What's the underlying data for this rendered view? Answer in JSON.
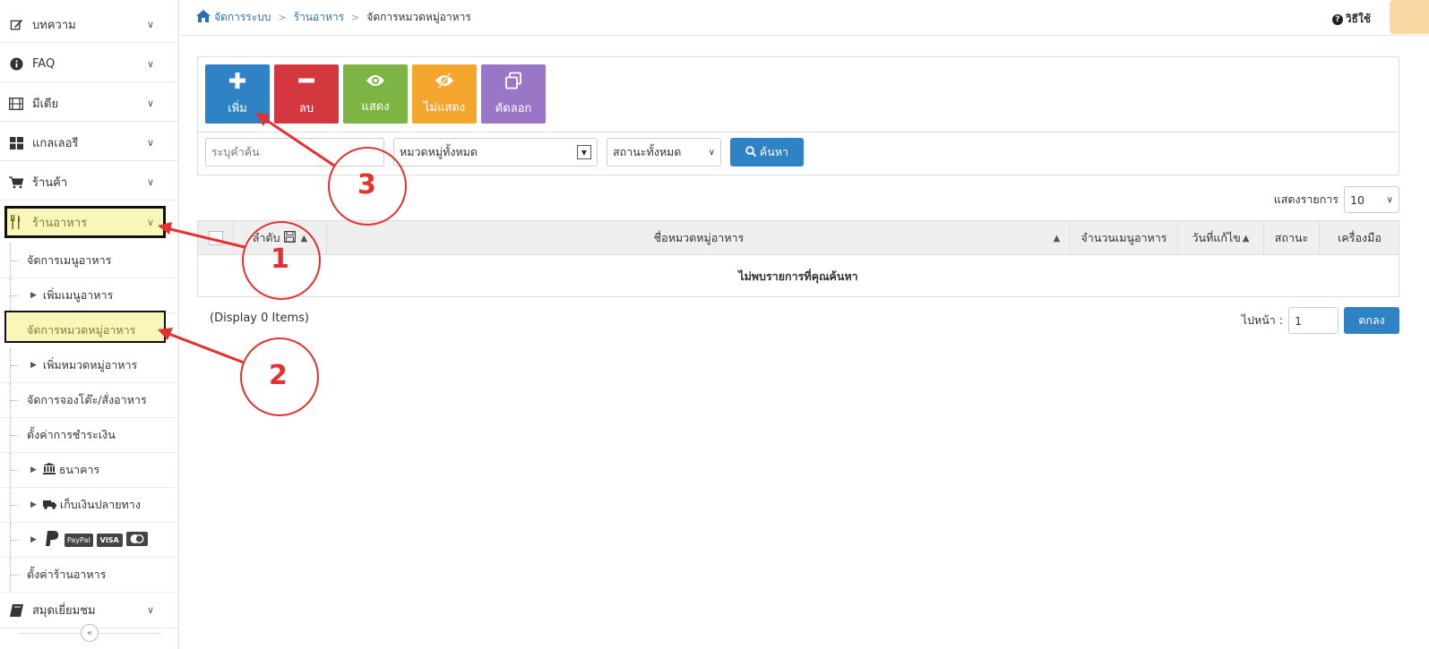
{
  "sidebar": {
    "items": [
      {
        "label": "บทความ",
        "icon": "edit-icon"
      },
      {
        "label": "FAQ",
        "icon": "info-icon"
      },
      {
        "label": "มีเดีย",
        "icon": "film-icon"
      },
      {
        "label": "แกลเลอรี",
        "icon": "grid-icon"
      },
      {
        "label": "ร้านค้า",
        "icon": "cart-icon"
      },
      {
        "label": "ร้านอาหาร",
        "icon": "utensils-icon"
      }
    ],
    "sub": {
      "menu_manage": "จัดการเมนูอาหาร",
      "menu_add": "เพิ่มเมนูอาหาร",
      "cat_manage": "จัดการหมวดหมู่อาหาร",
      "cat_add": "เพิ่มหมวดหมู่อาหาร",
      "booking": "จัดการจองโต๊ะ/สั่งอาหาร",
      "payment": "ตั้งค่าการชำระเงิน",
      "bank": "ธนาคาร",
      "cod": "เก็บเงินปลายทาง",
      "paypal": "PayPal",
      "visa": "VISA",
      "settings": "ตั้งค่าร้านอาหาร"
    },
    "guestbook": "สมุดเยี่ยมชม",
    "collapse": "«"
  },
  "header": {
    "breadcrumb": [
      "จัดการระบบ",
      "ร้านอาหาร",
      "จัดการหมวดหมู่อาหาร"
    ],
    "help": "วิธีใช้"
  },
  "toolbar": {
    "add": "เพิ่ม",
    "delete": "ลบ",
    "show": "แสดง",
    "hide": "ไม่แสดง",
    "copy": "คัดลอก"
  },
  "search": {
    "placeholder": "ระบุคำค้น",
    "category": "หมวดหมู่ทั้งหมด",
    "status": "สถานะทั้งหมด",
    "button": "ค้นหา"
  },
  "perpage": {
    "label": "แสดงรายการ",
    "value": "10"
  },
  "table": {
    "columns": [
      "ลำดับ",
      "ชื่อหมวดหมู่อาหาร",
      "จำนวนเมนูอาหาร",
      "วันที่แก้ไข",
      "สถานะ",
      "เครื่องมือ"
    ],
    "empty": "ไม่พบรายการที่คุณค้นหา"
  },
  "footer": {
    "display": "(Display 0 Items)",
    "goto_label": "ไปหน้า :",
    "goto_value": "1",
    "goto_button": "ตกลง"
  },
  "annotations": [
    "1",
    "2",
    "3"
  ],
  "colors": {
    "primary": "#2f82c4",
    "danger": "#d2383e",
    "success": "#7db443",
    "warning": "#f4a62f",
    "purple": "#9a77c6",
    "highlight": "#f8f6b8",
    "annotation": "#e53030"
  }
}
